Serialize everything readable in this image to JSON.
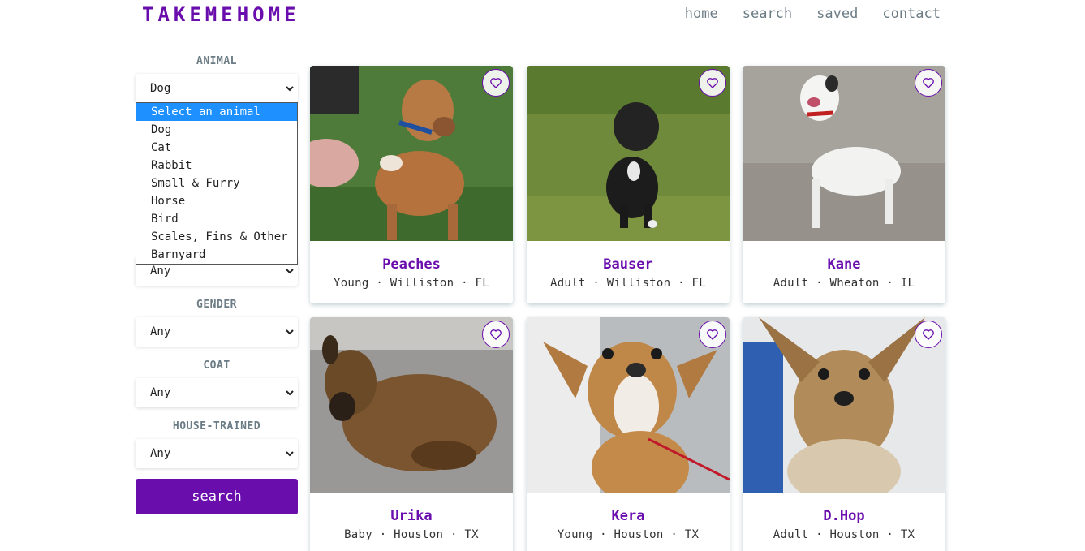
{
  "header": {
    "logo": "TAKEMEHOME",
    "nav": [
      "home",
      "search",
      "saved",
      "contact"
    ]
  },
  "filters": {
    "animal": {
      "label": "ANIMAL",
      "value": "Dog"
    },
    "breed": {
      "value": "Any"
    },
    "gender": {
      "label": "GENDER",
      "value": "Any"
    },
    "coat": {
      "label": "COAT",
      "value": "Any"
    },
    "house_trained": {
      "label": "HOUSE-TRAINED",
      "value": "Any"
    },
    "search_label": "search"
  },
  "animal_dropdown": {
    "options": [
      "Select an animal",
      "Dog",
      "Cat",
      "Rabbit",
      "Small & Furry",
      "Horse",
      "Bird",
      "Scales, Fins & Other",
      "Barnyard"
    ],
    "highlighted_index": 0
  },
  "pets": [
    {
      "name": "Peaches",
      "meta": "Young · Williston · FL"
    },
    {
      "name": "Bauser",
      "meta": "Adult · Williston · FL"
    },
    {
      "name": "Kane",
      "meta": "Adult · Wheaton · IL"
    },
    {
      "name": "Urika",
      "meta": "Baby · Houston · TX"
    },
    {
      "name": "Kera",
      "meta": "Young · Houston · TX"
    },
    {
      "name": "D.Hop",
      "meta": "Adult · Houston · TX"
    }
  ],
  "colors": {
    "accent": "#6a0dad",
    "nav_text": "#6b7c85",
    "highlight": "#1e90ff"
  },
  "icons": {
    "favorite": "heart-outline-icon",
    "select": "chevron-down-icon"
  }
}
